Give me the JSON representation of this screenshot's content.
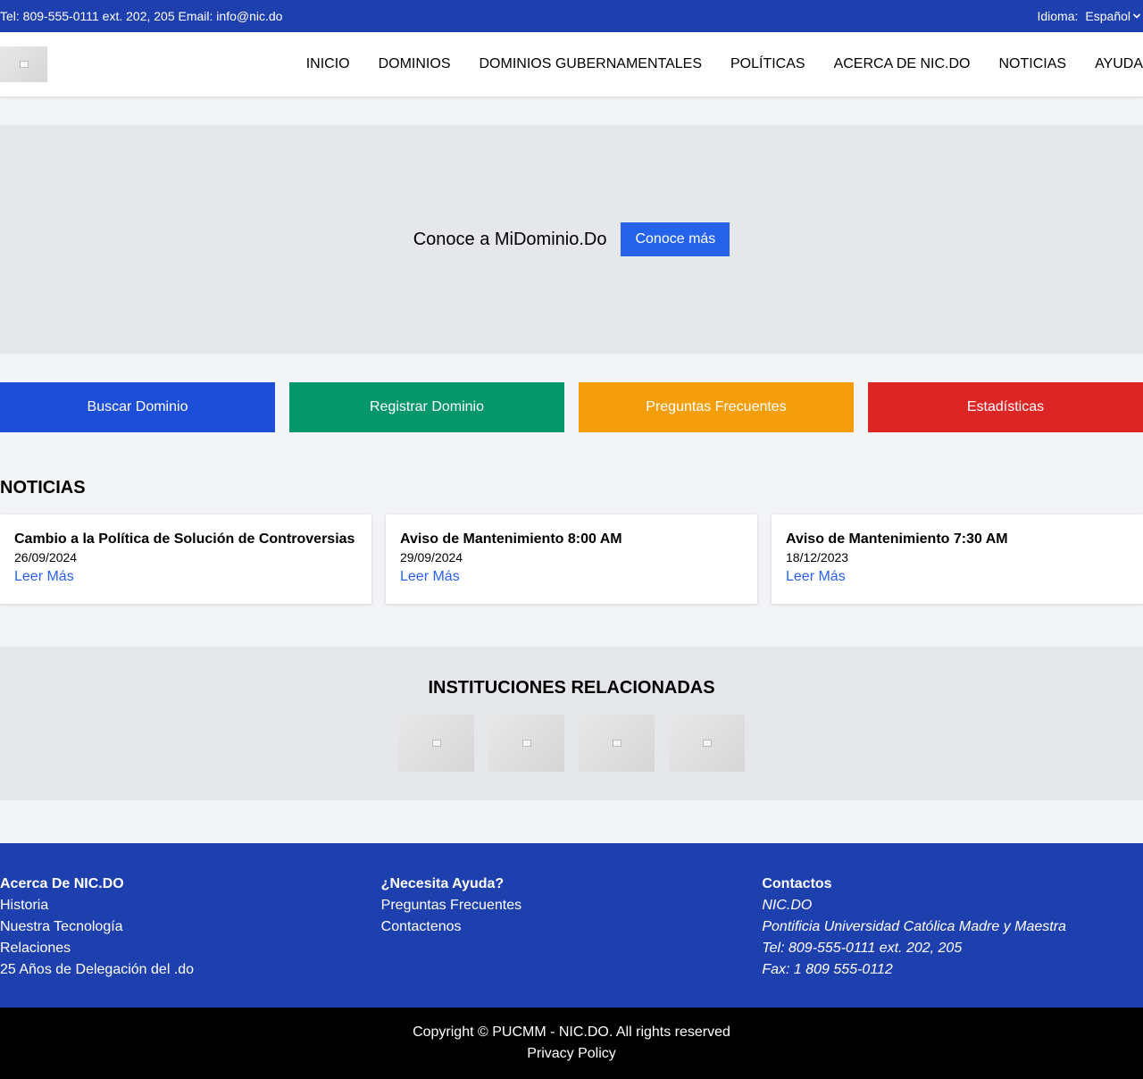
{
  "topbar": {
    "contact": "Tel: 809-555-0111 ext. 202, 205 Email: info@nic.do",
    "lang_label": "Idioma:",
    "lang_value": "Español"
  },
  "nav": {
    "items": [
      "INICIO",
      "DOMINIOS",
      "DOMINIOS GUBERNAMENTALES",
      "POLÍTICAS",
      "ACERCA DE NIC.DO",
      "NOTICIAS",
      "AYUDA"
    ]
  },
  "hero": {
    "text": "Conoce a MiDominio.Do",
    "button": "Conoce más"
  },
  "actions": [
    {
      "label": "Buscar Dominio",
      "color": "#1d4ed8"
    },
    {
      "label": "Registrar Dominio",
      "color": "#059669"
    },
    {
      "label": "Preguntas Frecuentes",
      "color": "#f59e0b"
    },
    {
      "label": "Estadísticas",
      "color": "#dc2626"
    }
  ],
  "news": {
    "title": "NOTICIAS",
    "items": [
      {
        "title": "Cambio a la Política de Solución de Controversias",
        "date": "26/09/2024",
        "link": "Leer Más"
      },
      {
        "title": "Aviso de Mantenimiento 8:00 AM",
        "date": "29/09/2024",
        "link": "Leer Más"
      },
      {
        "title": "Aviso de Mantenimiento 7:30 AM",
        "date": "18/12/2023",
        "link": "Leer Más"
      }
    ]
  },
  "institutions": {
    "title": "INSTITUCIONES RELACIONADAS"
  },
  "footer": {
    "col1": {
      "title": "Acerca De NIC.DO",
      "links": [
        "Historia",
        "Nuestra Tecnología",
        "Relaciones",
        "25 Años de Delegación del .do"
      ]
    },
    "col2": {
      "title": "¿Necesita Ayuda?",
      "links": [
        "Preguntas Frecuentes",
        "Contactenos"
      ]
    },
    "col3": {
      "title": "Contactos",
      "lines": [
        "NIC.DO",
        "Pontificia Universidad Católica Madre y Maestra",
        "Tel: 809-555-0111 ext. 202, 205",
        "Fax: 1 809 555-0112"
      ]
    }
  },
  "bottom": {
    "copyright": "Copyright © PUCMM - NIC.DO. All rights reserved",
    "privacy": "Privacy Policy"
  },
  "colors": {
    "brand_blue": "#1e40af",
    "accent_blue": "#2563eb"
  }
}
